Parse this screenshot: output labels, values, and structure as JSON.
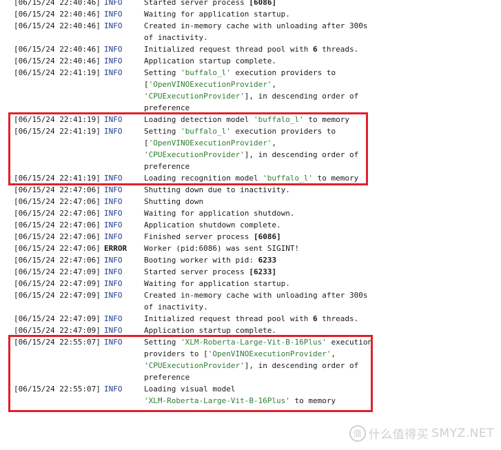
{
  "lines": [
    {
      "ts": "[06/15/24 22:40:46]",
      "level": "INFO",
      "error": false,
      "parts": [
        {
          "t": "Started server process ",
          "c": "txt"
        },
        {
          "t": "[6086]",
          "c": "num"
        }
      ]
    },
    {
      "ts": "[06/15/24 22:40:46]",
      "level": "INFO",
      "error": false,
      "parts": [
        {
          "t": "Waiting for application startup.",
          "c": "txt"
        }
      ]
    },
    {
      "ts": "[06/15/24 22:40:46]",
      "level": "INFO",
      "error": false,
      "parts": [
        {
          "t": "Created in-memory cache with unloading after 300s",
          "c": "txt"
        }
      ]
    },
    {
      "ts": "",
      "level": "",
      "error": false,
      "parts": [
        {
          "t": "of inactivity.",
          "c": "txt"
        }
      ]
    },
    {
      "ts": "[06/15/24 22:40:46]",
      "level": "INFO",
      "error": false,
      "parts": [
        {
          "t": "Initialized request thread pool with ",
          "c": "txt"
        },
        {
          "t": "6",
          "c": "num"
        },
        {
          "t": " threads.",
          "c": "txt"
        }
      ]
    },
    {
      "ts": "[06/15/24 22:40:46]",
      "level": "INFO",
      "error": false,
      "parts": [
        {
          "t": "Application startup complete.",
          "c": "txt"
        }
      ]
    },
    {
      "ts": "[06/15/24 22:41:19]",
      "level": "INFO",
      "error": false,
      "parts": [
        {
          "t": "Setting ",
          "c": "txt"
        },
        {
          "t": "'buffalo_l'",
          "c": "str"
        },
        {
          "t": " execution providers to",
          "c": "txt"
        }
      ]
    },
    {
      "ts": "",
      "level": "",
      "error": false,
      "parts": [
        {
          "t": "[",
          "c": "txt"
        },
        {
          "t": "'OpenVINOExecutionProvider'",
          "c": "str"
        },
        {
          "t": ",",
          "c": "txt"
        }
      ]
    },
    {
      "ts": "",
      "level": "",
      "error": false,
      "parts": [
        {
          "t": "'CPUExecutionProvider'",
          "c": "str"
        },
        {
          "t": "], in descending order of",
          "c": "txt"
        }
      ]
    },
    {
      "ts": "",
      "level": "",
      "error": false,
      "parts": [
        {
          "t": "preference",
          "c": "txt"
        }
      ]
    },
    {
      "ts": "[06/15/24 22:41:19]",
      "level": "INFO",
      "error": false,
      "parts": [
        {
          "t": "Loading detection model ",
          "c": "txt"
        },
        {
          "t": "'buffalo_l'",
          "c": "str"
        },
        {
          "t": " to memory",
          "c": "txt"
        }
      ]
    },
    {
      "ts": "[06/15/24 22:41:19]",
      "level": "INFO",
      "error": false,
      "parts": [
        {
          "t": "Setting ",
          "c": "txt"
        },
        {
          "t": "'buffalo_l'",
          "c": "str"
        },
        {
          "t": " execution providers to",
          "c": "txt"
        }
      ]
    },
    {
      "ts": "",
      "level": "",
      "error": false,
      "parts": [
        {
          "t": "[",
          "c": "txt"
        },
        {
          "t": "'OpenVINOExecutionProvider'",
          "c": "str"
        },
        {
          "t": ",",
          "c": "txt"
        }
      ]
    },
    {
      "ts": "",
      "level": "",
      "error": false,
      "parts": [
        {
          "t": "'CPUExecutionProvider'",
          "c": "str"
        },
        {
          "t": "], in descending order of",
          "c": "txt"
        }
      ]
    },
    {
      "ts": "",
      "level": "",
      "error": false,
      "parts": [
        {
          "t": "preference",
          "c": "txt"
        }
      ]
    },
    {
      "ts": "[06/15/24 22:41:19]",
      "level": "INFO",
      "error": false,
      "parts": [
        {
          "t": "Loading recognition model ",
          "c": "txt"
        },
        {
          "t": "'buffalo_l'",
          "c": "str"
        },
        {
          "t": " to memory",
          "c": "txt"
        }
      ]
    },
    {
      "ts": "[06/15/24 22:47:06]",
      "level": "INFO",
      "error": false,
      "parts": [
        {
          "t": "Shutting down due to inactivity.",
          "c": "txt"
        }
      ]
    },
    {
      "ts": "[06/15/24 22:47:06]",
      "level": "INFO",
      "error": false,
      "parts": [
        {
          "t": "Shutting down",
          "c": "txt"
        }
      ]
    },
    {
      "ts": "[06/15/24 22:47:06]",
      "level": "INFO",
      "error": false,
      "parts": [
        {
          "t": "Waiting for application shutdown.",
          "c": "txt"
        }
      ]
    },
    {
      "ts": "[06/15/24 22:47:06]",
      "level": "INFO",
      "error": false,
      "parts": [
        {
          "t": "Application shutdown complete.",
          "c": "txt"
        }
      ]
    },
    {
      "ts": "[06/15/24 22:47:06]",
      "level": "INFO",
      "error": false,
      "parts": [
        {
          "t": "Finished server process ",
          "c": "txt"
        },
        {
          "t": "[6086]",
          "c": "num"
        }
      ]
    },
    {
      "ts": "[06/15/24 22:47:06]",
      "level": "ERROR",
      "error": true,
      "parts": [
        {
          "t": "Worker (pid:6086) was sent SIGINT!",
          "c": "txt"
        }
      ]
    },
    {
      "ts": "[06/15/24 22:47:06]",
      "level": "INFO",
      "error": false,
      "parts": [
        {
          "t": "Booting worker with pid: ",
          "c": "txt"
        },
        {
          "t": "6233",
          "c": "num"
        }
      ]
    },
    {
      "ts": "[06/15/24 22:47:09]",
      "level": "INFO",
      "error": false,
      "parts": [
        {
          "t": "Started server process ",
          "c": "txt"
        },
        {
          "t": "[6233]",
          "c": "num"
        }
      ]
    },
    {
      "ts": "[06/15/24 22:47:09]",
      "level": "INFO",
      "error": false,
      "parts": [
        {
          "t": "Waiting for application startup.",
          "c": "txt"
        }
      ]
    },
    {
      "ts": "[06/15/24 22:47:09]",
      "level": "INFO",
      "error": false,
      "parts": [
        {
          "t": "Created in-memory cache with unloading after 300s",
          "c": "txt"
        }
      ]
    },
    {
      "ts": "",
      "level": "",
      "error": false,
      "parts": [
        {
          "t": "of inactivity.",
          "c": "txt"
        }
      ]
    },
    {
      "ts": "[06/15/24 22:47:09]",
      "level": "INFO",
      "error": false,
      "parts": [
        {
          "t": "Initialized request thread pool with ",
          "c": "txt"
        },
        {
          "t": "6",
          "c": "num"
        },
        {
          "t": " threads.",
          "c": "txt"
        }
      ]
    },
    {
      "ts": "[06/15/24 22:47:09]",
      "level": "INFO",
      "error": false,
      "parts": [
        {
          "t": "Application startup complete.",
          "c": "txt"
        }
      ]
    },
    {
      "ts": "[06/15/24 22:55:07]",
      "level": "INFO",
      "error": false,
      "parts": [
        {
          "t": "Setting ",
          "c": "txt"
        },
        {
          "t": "'XLM-Roberta-Large-Vit-B-16Plus'",
          "c": "str"
        },
        {
          "t": " execution",
          "c": "txt"
        }
      ]
    },
    {
      "ts": "",
      "level": "",
      "error": false,
      "parts": [
        {
          "t": "providers to [",
          "c": "txt"
        },
        {
          "t": "'OpenVINOExecutionProvider'",
          "c": "str"
        },
        {
          "t": ",",
          "c": "txt"
        }
      ]
    },
    {
      "ts": "",
      "level": "",
      "error": false,
      "parts": [
        {
          "t": "'CPUExecutionProvider'",
          "c": "str"
        },
        {
          "t": "], in descending order of",
          "c": "txt"
        }
      ]
    },
    {
      "ts": "",
      "level": "",
      "error": false,
      "parts": [
        {
          "t": "preference",
          "c": "txt"
        }
      ]
    },
    {
      "ts": "[06/15/24 22:55:07]",
      "level": "INFO",
      "error": false,
      "parts": [
        {
          "t": "Loading visual model",
          "c": "txt"
        }
      ]
    },
    {
      "ts": "",
      "level": "",
      "error": false,
      "parts": [
        {
          "t": "'XLM-Roberta-Large-Vit-B-16Plus'",
          "c": "str"
        },
        {
          "t": " to memory",
          "c": "txt"
        }
      ]
    }
  ],
  "highlight_groups": [
    {
      "first_line": 10,
      "last_line": 15
    },
    {
      "first_line": 29,
      "last_line": 34
    }
  ],
  "watermark": {
    "mark": "值",
    "text": "什么值得买",
    "site": "SMYZ.NET"
  },
  "colors": {
    "info": "#1f3b8c",
    "string": "#2e7d32",
    "highlight": "#e0202a"
  }
}
